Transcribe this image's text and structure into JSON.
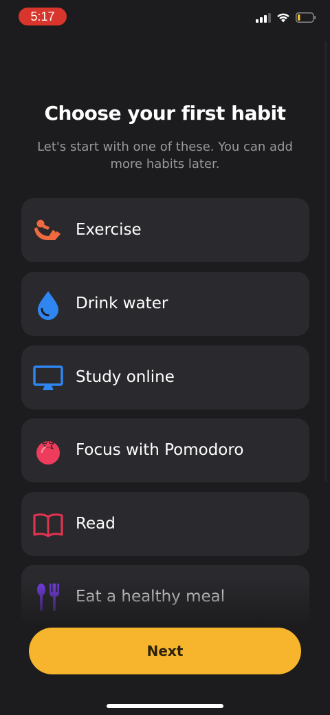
{
  "status_bar": {
    "time": "5:17",
    "icons": [
      "cellular-signal-icon",
      "wifi-icon",
      "battery-low-icon"
    ],
    "colors": {
      "time_pill": "#d8352c",
      "battery_level": "#f2c230"
    }
  },
  "header": {
    "title": "Choose your first habit",
    "subtitle": "Let's start with one of these. You can add more habits later."
  },
  "habits": [
    {
      "label": "Exercise",
      "icon": "exercise-icon",
      "color": "#f06a3f"
    },
    {
      "label": "Drink water",
      "icon": "water-drop-icon",
      "color": "#2f86f0"
    },
    {
      "label": "Study online",
      "icon": "monitor-icon",
      "color": "#2f86f0"
    },
    {
      "label": "Focus with Pomodoro",
      "icon": "tomato-icon",
      "color": "#ee3c5c"
    },
    {
      "label": "Read",
      "icon": "book-icon",
      "color": "#e0344f"
    },
    {
      "label": "Eat a healthy meal",
      "icon": "utensils-icon",
      "color": "#7a3ff0"
    }
  ],
  "footer": {
    "next_label": "Next",
    "colors": {
      "next_button": "#f6b52c"
    }
  },
  "theme": {
    "background": "#1c1b1d",
    "card": "#2a292d",
    "subtitle": "#9a999d"
  }
}
